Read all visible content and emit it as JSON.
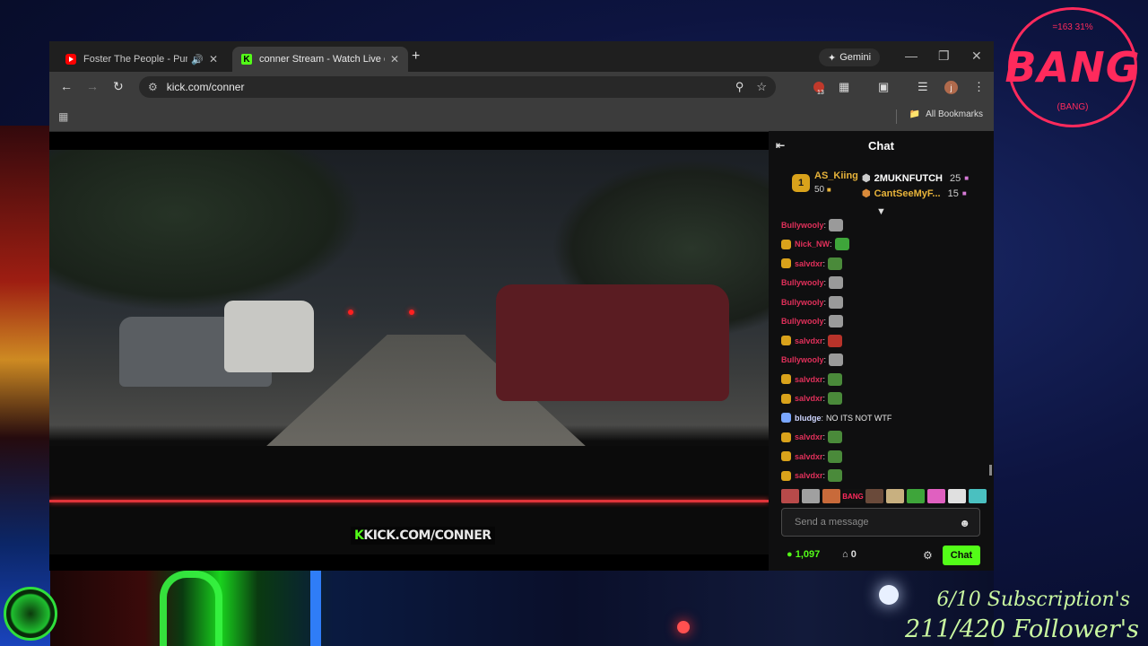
{
  "overlay": {
    "logo_text": "BANG",
    "logo_arc_top": "=163 31%",
    "logo_arc_bottom": "(BANG)",
    "subscriptions": "6/10 Subscription's",
    "followers": "211/420 Follower's"
  },
  "browser": {
    "tabs": [
      {
        "title": "Foster The People - Pumped Up Kicks",
        "favicon": "youtube-icon",
        "audio": true
      },
      {
        "title": "conner Stream - Watch Live on Kick",
        "favicon": "kick-icon",
        "active": true
      }
    ],
    "new_tab": "+",
    "gemini_label": "Gemini",
    "url": "kick.com/conner",
    "extension_badge": "13",
    "profile_initial": "j",
    "bookmarks_label": "All Bookmarks"
  },
  "video": {
    "watermark_logo": "K",
    "watermark_text": "KICK.COM/CONNER"
  },
  "chat": {
    "title": "Chat",
    "leaderboard": {
      "first": {
        "rank": "1",
        "name": "AS_Kiing",
        "count": "50"
      },
      "second": {
        "name": "2MUKNFUTCH",
        "count": "25"
      },
      "third": {
        "name": "CantSeeMyF...",
        "count": "15"
      }
    },
    "messages": [
      {
        "user": "Bullywooly",
        "text": "",
        "badge": false,
        "emote": "#9a9a9a"
      },
      {
        "user": "Nick_NW",
        "text": "",
        "badge": true,
        "emote": "#3ea53a"
      },
      {
        "user": "salvdxr",
        "text": "",
        "badge": true,
        "emote": "#4a8a3a"
      },
      {
        "user": "Bullywooly",
        "text": "",
        "badge": false,
        "emote": "#9a9a9a"
      },
      {
        "user": "Bullywooly",
        "text": "",
        "badge": false,
        "emote": "#9a9a9a"
      },
      {
        "user": "Bullywooly",
        "text": "",
        "badge": false,
        "emote": "#9a9a9a"
      },
      {
        "user": "salvdxr",
        "text": "",
        "badge": true,
        "emote": "#b8332a"
      },
      {
        "user": "Bullywooly",
        "text": "",
        "badge": false,
        "emote": "#9a9a9a"
      },
      {
        "user": "salvdxr",
        "text": "",
        "badge": true,
        "emote": "#4a8a3a"
      },
      {
        "user": "salvdxr",
        "text": "",
        "badge": true,
        "emote": "#4a8a3a"
      },
      {
        "user": "bludge",
        "text": "NO ITS NOT WTF",
        "badge": true,
        "emote": ""
      },
      {
        "user": "salvdxr",
        "text": "",
        "badge": true,
        "emote": "#4a8a3a"
      },
      {
        "user": "salvdxr",
        "text": "",
        "badge": true,
        "emote": "#4a8a3a"
      },
      {
        "user": "salvdxr",
        "text": "",
        "badge": true,
        "emote": "#4a8a3a"
      }
    ],
    "emote_bar": [
      "#b84a4a",
      "#a0a0a0",
      "#c86a3a",
      "BANG",
      "#6a4a3a",
      "#c8b080",
      "#3ea53a",
      "#e060c0",
      "#e0e0e0",
      "#4ac0c0"
    ],
    "input_placeholder": "Send a message",
    "kicks_count": "1,097",
    "store_count": "0",
    "send_label": "Chat"
  }
}
